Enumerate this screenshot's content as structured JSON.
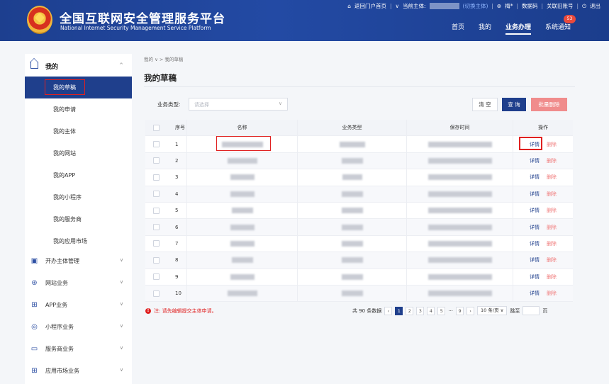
{
  "header": {
    "title": "全国互联网安全管理服务平台",
    "subtitle": "National Internet Security Management Service Platform",
    "top_links": {
      "portal": "返回门户首页",
      "current_subject_label": "当前主体:",
      "switch_subject": "(切换主体)",
      "user": "梅*",
      "digital_code": "数据码",
      "link_old_account": "关联旧账号",
      "logout": "退出"
    },
    "nav": [
      "首页",
      "我的",
      "业务办理",
      "系统通知"
    ],
    "notification_count": "53"
  },
  "sidebar": {
    "my_label": "我的",
    "my_items": [
      "我的草稿",
      "我的申请",
      "我的主体",
      "我的网站",
      "我的APP",
      "我的小程序",
      "我的服务商",
      "我的应用市场"
    ],
    "groups": [
      "开办主体管理",
      "网站业务",
      "APP业务",
      "小程序业务",
      "服务商业务",
      "应用市场业务"
    ]
  },
  "breadcrumb": {
    "root": "我的",
    "current": "我的草稿"
  },
  "page_title": "我的草稿",
  "filter": {
    "label": "业务类型:",
    "placeholder": "请选择"
  },
  "buttons": {
    "clear": "清 空",
    "query": "查 询",
    "batch_delete": "批量删除"
  },
  "table": {
    "columns": [
      "序号",
      "名称",
      "业务类型",
      "保存时间",
      "操作"
    ],
    "rows": [
      "1",
      "2",
      "3",
      "4",
      "5",
      "6",
      "7",
      "8",
      "9",
      "10"
    ],
    "detail_label": "详情",
    "delete_label": "删除"
  },
  "note": "注: 请先编辑提交主体申请。",
  "pagination": {
    "total": "共 90 条数据",
    "pages": [
      "1",
      "2",
      "3",
      "4",
      "5",
      "···",
      "9"
    ],
    "page_size": "10 条/页",
    "goto": "跳至",
    "page_unit": "页"
  }
}
